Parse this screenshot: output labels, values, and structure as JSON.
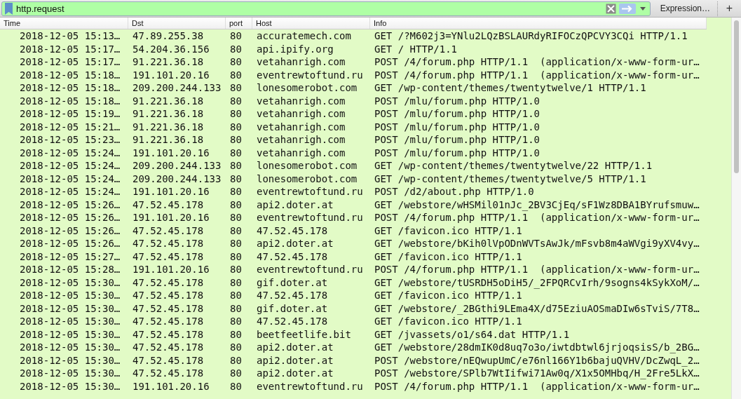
{
  "filter_bar": {
    "value": "http.request",
    "expression_button": "Expression…",
    "add_button": "+"
  },
  "table": {
    "columns": [
      "Time",
      "Dst",
      "port",
      "Host",
      "Info"
    ],
    "rows": [
      [
        "2018-12-05 15:13…",
        "47.89.255.38",
        "80",
        "accuratemech.com",
        "GET /?M602j3=YNlu2LQzBSLAURdyRIFOCzQPCVY3CQi HTTP/1.1"
      ],
      [
        "2018-12-05 15:17…",
        "54.204.36.156",
        "80",
        "api.ipify.org",
        "GET / HTTP/1.1"
      ],
      [
        "2018-12-05 15:17…",
        "91.221.36.18",
        "80",
        "vetahanrigh.com",
        "POST /4/forum.php HTTP/1.1  (application/x-www-form-ur…"
      ],
      [
        "2018-12-05 15:18…",
        "191.101.20.16",
        "80",
        "eventrewtoftund.ru",
        "POST /4/forum.php HTTP/1.1  (application/x-www-form-ur…"
      ],
      [
        "2018-12-05 15:18…",
        "209.200.244.133",
        "80",
        "lonesomerobot.com",
        "GET /wp-content/themes/twentytwelve/1 HTTP/1.1"
      ],
      [
        "2018-12-05 15:18…",
        "91.221.36.18",
        "80",
        "vetahanrigh.com",
        "POST /mlu/forum.php HTTP/1.0"
      ],
      [
        "2018-12-05 15:19…",
        "91.221.36.18",
        "80",
        "vetahanrigh.com",
        "POST /mlu/forum.php HTTP/1.0"
      ],
      [
        "2018-12-05 15:21…",
        "91.221.36.18",
        "80",
        "vetahanrigh.com",
        "POST /mlu/forum.php HTTP/1.0"
      ],
      [
        "2018-12-05 15:23…",
        "91.221.36.18",
        "80",
        "vetahanrigh.com",
        "POST /mlu/forum.php HTTP/1.0"
      ],
      [
        "2018-12-05 15:24…",
        "191.101.20.16",
        "80",
        "vetahanrigh.com",
        "POST /mlu/forum.php HTTP/1.0"
      ],
      [
        "2018-12-05 15:24…",
        "209.200.244.133",
        "80",
        "lonesomerobot.com",
        "GET /wp-content/themes/twentytwelve/22 HTTP/1.1"
      ],
      [
        "2018-12-05 15:24…",
        "209.200.244.133",
        "80",
        "lonesomerobot.com",
        "GET /wp-content/themes/twentytwelve/5 HTTP/1.1"
      ],
      [
        "2018-12-05 15:24…",
        "191.101.20.16",
        "80",
        "eventrewtoftund.ru",
        "POST /d2/about.php HTTP/1.0"
      ],
      [
        "2018-12-05 15:26…",
        "47.52.45.178",
        "80",
        "api2.doter.at",
        "GET /webstore/wHSMil01nJc_2BV3CjEq/sF1Wz8DBA1BYrufsmuw…"
      ],
      [
        "2018-12-05 15:26…",
        "191.101.20.16",
        "80",
        "eventrewtoftund.ru",
        "POST /4/forum.php HTTP/1.1  (application/x-www-form-ur…"
      ],
      [
        "2018-12-05 15:26…",
        "47.52.45.178",
        "80",
        "47.52.45.178",
        "GET /favicon.ico HTTP/1.1"
      ],
      [
        "2018-12-05 15:26…",
        "47.52.45.178",
        "80",
        "api2.doter.at",
        "GET /webstore/bKih0lVpODnWVTsAwJk/mFsvb8m4aWVgi9yXV4vy…"
      ],
      [
        "2018-12-05 15:27…",
        "47.52.45.178",
        "80",
        "47.52.45.178",
        "GET /favicon.ico HTTP/1.1"
      ],
      [
        "2018-12-05 15:28…",
        "191.101.20.16",
        "80",
        "eventrewtoftund.ru",
        "POST /4/forum.php HTTP/1.1  (application/x-www-form-ur…"
      ],
      [
        "2018-12-05 15:30…",
        "47.52.45.178",
        "80",
        "gif.doter.at",
        "GET /webstore/tUSRDH5oDiH5/_2FPQRCvIrh/9sogns4kSykXoM/…"
      ],
      [
        "2018-12-05 15:30…",
        "47.52.45.178",
        "80",
        "47.52.45.178",
        "GET /favicon.ico HTTP/1.1"
      ],
      [
        "2018-12-05 15:30…",
        "47.52.45.178",
        "80",
        "gif.doter.at",
        "GET /webstore/_2BGthi9LEma4X/d75EziuAOSmaDIw6sTviS/7T8…"
      ],
      [
        "2018-12-05 15:30…",
        "47.52.45.178",
        "80",
        "47.52.45.178",
        "GET /favicon.ico HTTP/1.1"
      ],
      [
        "2018-12-05 15:30…",
        "47.52.45.178",
        "80",
        "beetfeetlife.bit",
        "GET /jvassets/o1/s64.dat HTTP/1.1"
      ],
      [
        "2018-12-05 15:30…",
        "47.52.45.178",
        "80",
        "api2.doter.at",
        "GET /webstore/28dmIK0d8uq7o3o/iwtdbtwl6jrjoqsisS/b_2BG…"
      ],
      [
        "2018-12-05 15:30…",
        "47.52.45.178",
        "80",
        "api2.doter.at",
        "POST /webstore/nEQwupUmC/e76nl166Y1b6bajuQVHV/DcZwqL_2…"
      ],
      [
        "2018-12-05 15:30…",
        "47.52.45.178",
        "80",
        "api2.doter.at",
        "POST /webstore/SPlb7WtIifwi71Aw0q/X1x5OMHbq/H_2Fre5LkX…"
      ],
      [
        "2018-12-05 15:30…",
        "191.101.20.16",
        "80",
        "eventrewtoftund.ru",
        "POST /4/forum.php HTTP/1.1  (application/x-www-form-ur…"
      ]
    ]
  }
}
